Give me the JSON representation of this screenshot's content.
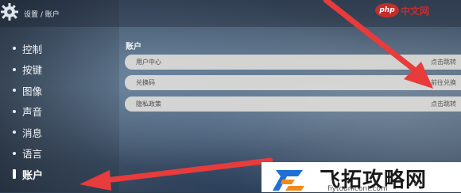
{
  "header": {
    "breadcrumb": "设置 / 账户"
  },
  "site_logo": {
    "badge": "php",
    "text": "中文网"
  },
  "sidebar": {
    "items": [
      {
        "label": "控制"
      },
      {
        "label": "按键"
      },
      {
        "label": "图像"
      },
      {
        "label": "声音"
      },
      {
        "label": "消息"
      },
      {
        "label": "语言"
      },
      {
        "label": "账户"
      }
    ],
    "active_index": 6
  },
  "content": {
    "section_title": "账户",
    "rows": [
      {
        "label": "用户中心",
        "action": "点击跳转"
      },
      {
        "label": "兑换码",
        "action": "前往兑换"
      },
      {
        "label": "隐私政策",
        "action": "点击跳转"
      }
    ]
  },
  "watermark": {
    "title": "飞拓攻略网",
    "url": "fiytounicont.com"
  },
  "colors": {
    "arrow": "#e83b3b",
    "watermark_blue": "#1f6fd6",
    "watermark_orange": "#f08a1c"
  }
}
